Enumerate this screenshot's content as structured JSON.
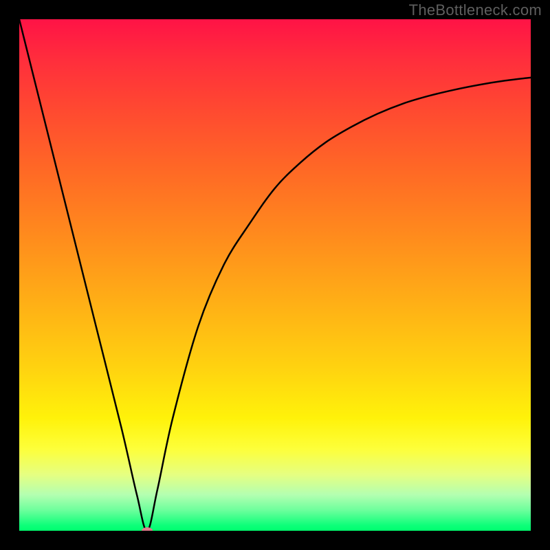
{
  "watermark": "TheBottleneck.com",
  "chart_data": {
    "type": "line",
    "title": "",
    "subtitle": "",
    "xlabel": "",
    "ylabel": "",
    "xlim": [
      0,
      100
    ],
    "ylim": [
      0,
      100
    ],
    "grid": false,
    "legend": null,
    "annotations": [
      {
        "text": "TheBottleneck.com",
        "position": "top-right"
      }
    ],
    "notes": "No axis tick labels are visible; the chart shows a single black curve with a sharp minimum indicating an optimal pairing (bottleneck calculator style). x and y values below are estimated from the visible curve shape against the plot area. A small pink marker sits at the curve's minimum near (25, 0).",
    "series": [
      {
        "name": "Bottleneck curve",
        "color": "#000000",
        "x": [
          0,
          5,
          10,
          15,
          20,
          23,
          25,
          27,
          30,
          35,
          40,
          45,
          50,
          55,
          60,
          65,
          70,
          75,
          80,
          85,
          90,
          95,
          100
        ],
        "values": [
          100,
          80,
          60,
          40,
          20,
          7,
          0,
          8,
          22,
          40,
          52,
          60,
          67,
          72,
          76,
          79,
          81.5,
          83.5,
          85,
          86.2,
          87.2,
          88,
          88.6
        ]
      }
    ],
    "marker": {
      "x": 25,
      "y": 0,
      "color": "#e07a8b",
      "rx": 8,
      "ry": 5
    }
  }
}
